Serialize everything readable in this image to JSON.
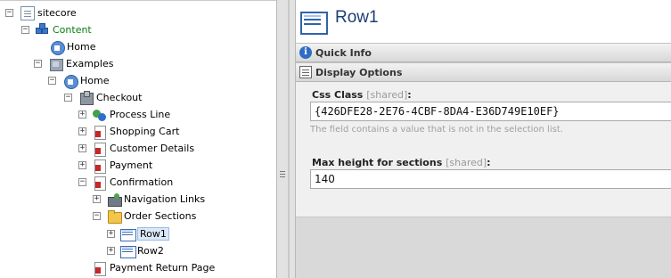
{
  "tree": {
    "nodes": [
      {
        "label": "sitecore",
        "icon": "document-icon"
      },
      {
        "label": "Content",
        "icon": "cubes-icon"
      },
      {
        "label": "Home",
        "icon": "home-icon"
      },
      {
        "label": "Examples",
        "icon": "examples-icon"
      },
      {
        "label": "Home",
        "icon": "home-icon"
      },
      {
        "label": "Checkout",
        "icon": "checkout-icon"
      },
      {
        "label": "Process Line",
        "icon": "process-icon"
      },
      {
        "label": "Shopping Cart",
        "icon": "page-icon"
      },
      {
        "label": "Customer Details",
        "icon": "page-icon"
      },
      {
        "label": "Payment",
        "icon": "page-icon"
      },
      {
        "label": "Confirmation",
        "icon": "page-icon"
      },
      {
        "label": "Navigation Links",
        "icon": "navigation-icon"
      },
      {
        "label": "Order Sections",
        "icon": "folder-icon"
      },
      {
        "label": "Row1",
        "icon": "row-icon"
      },
      {
        "label": "Row2",
        "icon": "row-icon"
      },
      {
        "label": "Payment Return Page",
        "icon": "page-icon"
      }
    ],
    "selected": "Row1"
  },
  "editor": {
    "title": "Row1",
    "sections": {
      "quick_info": "Quick Info",
      "display_options": "Display Options"
    },
    "fields": {
      "css_class": {
        "label": "Css Class",
        "shared": "[shared]",
        "colon": ":",
        "value": "{426DFE28-2E76-4CBF-8DA4-E36D749E10EF}",
        "message": "The field contains a value that is not in the selection list."
      },
      "max_height": {
        "label": "Max height for sections",
        "shared": "[shared]",
        "colon": ":",
        "value": "140"
      }
    }
  },
  "colors": {
    "title": "#1c3f73",
    "content_label": "#0a7d11",
    "selection_bg": "#dbe8f8"
  }
}
